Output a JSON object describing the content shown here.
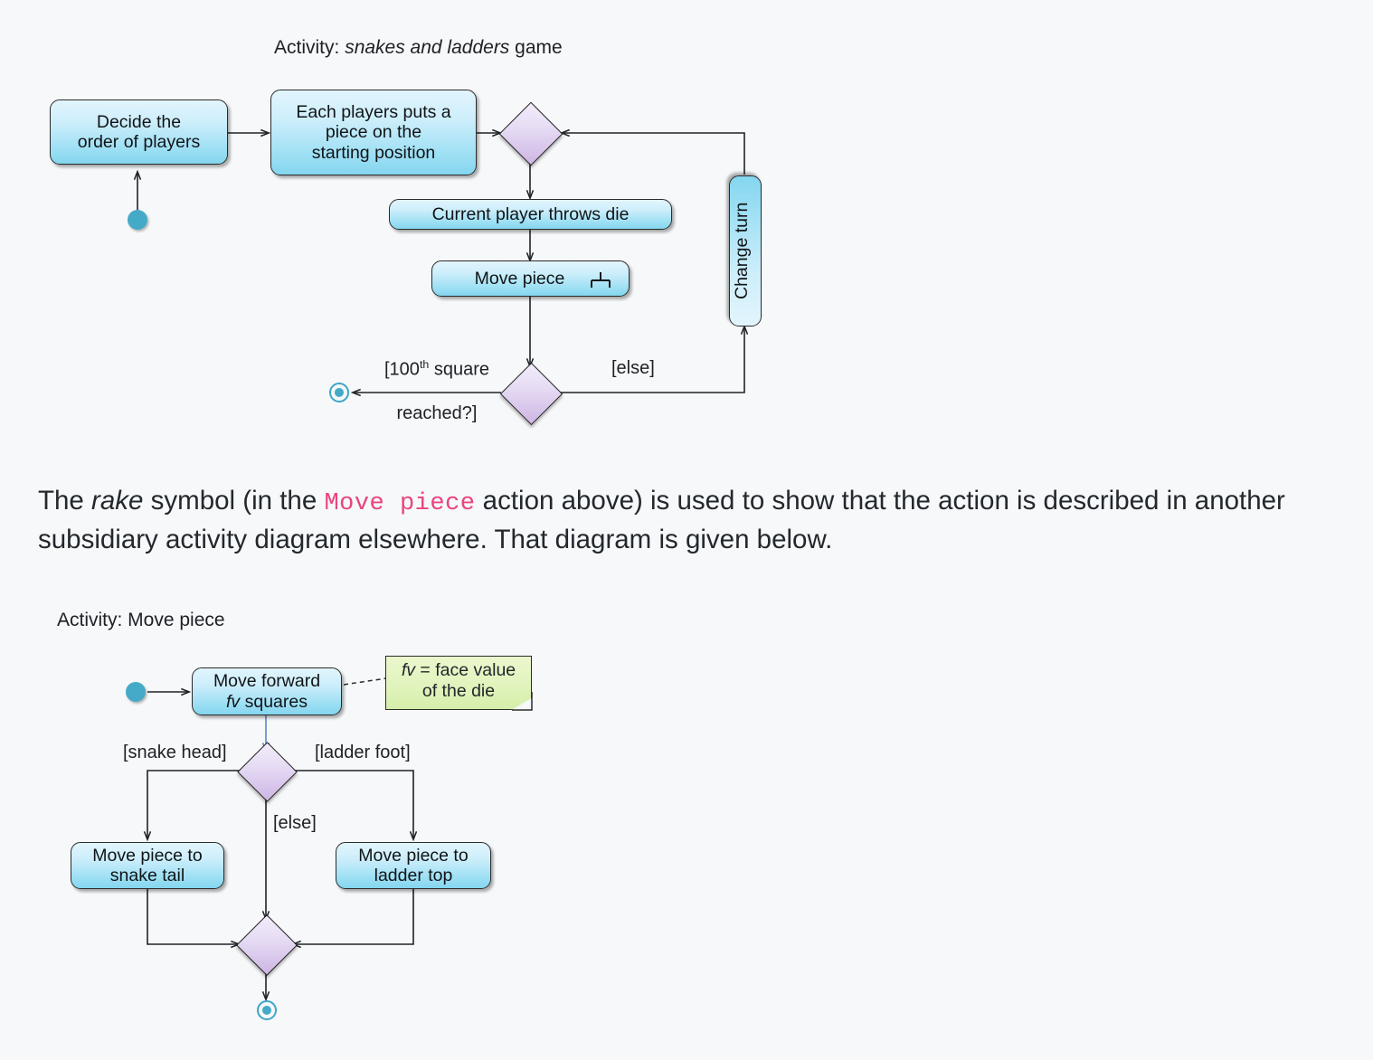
{
  "page": {
    "background_color": "#f6f8fa",
    "accent_node_color": "#45aac7",
    "action_fill_color": "#9fe0f4",
    "decision_fill_color": "#cdb5e4",
    "note_fill_color": "#dcf0b0",
    "code_color": "#ea4380"
  },
  "diagram_top": {
    "title_prefix": "Activity:",
    "title_italic": "snakes and ladders",
    "title_suffix": "game",
    "nodes": {
      "initial": "initial-node",
      "decide_order": "Decide the\norder of players",
      "decide_order_line1": "Decide the",
      "decide_order_line2": "order of players",
      "place_piece_line1": "Each players puts a",
      "place_piece_line2": "piece on the",
      "place_piece_line3": "starting position",
      "throw_die": "Current player throws die",
      "move_piece": "Move piece",
      "move_piece_rake_icon": "rake-icon",
      "change_turn": "Change turn",
      "final": "final-node"
    },
    "guards": {
      "reached_line1_pre": "[100",
      "reached_line1_sup": "th",
      "reached_line1_post": " square",
      "reached_line2": "reached?]",
      "else": "[else]"
    }
  },
  "body_text": {
    "part1": "The ",
    "part2_italic": "rake",
    "part3": " symbol (in the ",
    "part4_code": "Move piece",
    "part5": " action above) is used to show that the action is described in another subsidiary activity diagram elsewhere. That diagram is given below."
  },
  "diagram_bottom": {
    "title": "Activity: Move piece",
    "nodes": {
      "initial": "initial-node",
      "move_forward_line1": "Move forward",
      "move_forward_line2_italic": "fv",
      "move_forward_line2_rest": " squares",
      "note_line1_italic": "fv",
      "note_line1_rest": " = face value",
      "note_line2": "of the die",
      "snake_tail_line1": "Move piece to",
      "snake_tail_line2": "snake tail",
      "ladder_top_line1": "Move piece to",
      "ladder_top_line2": "ladder top",
      "final": "final-node"
    },
    "guards": {
      "snake_head": "[snake head]",
      "ladder_foot": "[ladder foot]",
      "else": "[else]"
    }
  }
}
